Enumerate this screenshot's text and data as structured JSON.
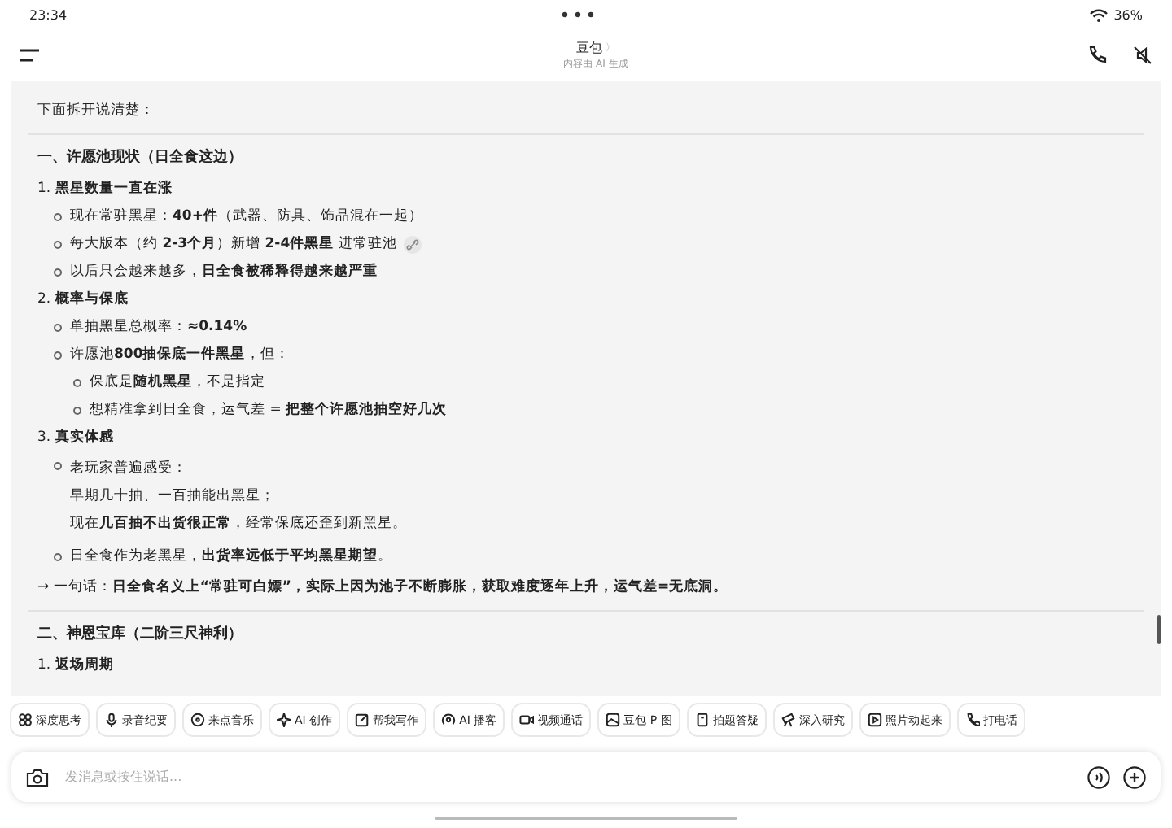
{
  "status_bar": {
    "time": "23:34",
    "battery": "36%"
  },
  "header": {
    "title": "豆包",
    "chevron": "〉",
    "subtitle": "内容由 AI 生成"
  },
  "content": [
    {
      "kind": "paragraph",
      "text": "下面拆开说清楚："
    },
    {
      "kind": "divider"
    },
    {
      "kind": "heading",
      "text": "一、许愿池现状（日全食这边）"
    },
    {
      "kind": "numbered",
      "number": "1.",
      "text": "黑星数量一直在涨",
      "children": [
        {
          "text": "现在常驻黑星：**40+件**（武器、防具、饰品混在一起）",
          "link": false
        },
        {
          "text": "每大版本（约 **2-3个月**）新增 **2-4件黑星** 进常驻池",
          "link": true
        },
        {
          "text": "以后只会越来越多，**日全食被稀释得越来越严重**",
          "link": false
        }
      ]
    },
    {
      "kind": "numbered",
      "number": "2.",
      "text": "概率与保底",
      "children": [
        {
          "text": "单抽黑星总概率：**≈0.14%**",
          "link": false
        },
        {
          "text": "许愿池**800抽保底一件黑星**，但：",
          "link": false,
          "children": [
            {
              "text": "保底是**随机黑星**，不是指定"
            },
            {
              "text": "想精准拿到日全食，运气差 = **把整个许愿池抽空好几次**"
            }
          ]
        }
      ]
    },
    {
      "kind": "numbered",
      "number": "3.",
      "text": "真实体感",
      "children": [
        {
          "lines": [
            "老玩家普遍感受：",
            "早期几十抽、一百抽能出黑星；",
            "现在**几百抽不出货很正常**，经常保底还歪到新黑星。"
          ],
          "link": false
        },
        {
          "text": "日全食作为老黑星，**出货率远低于平均黑星期望**。",
          "link": false
        }
      ]
    },
    {
      "kind": "paragraph",
      "text": "→ 一句话：**日全食名义上“常驻可白嫖”，实际上因为池子不断膨胀，获取难度逐年上升，运气差=无底洞。**"
    },
    {
      "kind": "divider"
    },
    {
      "kind": "heading",
      "text": "二、神恩宝库（二阶三尺神利）"
    },
    {
      "kind": "numbered",
      "number": "1.",
      "text": "返场周期"
    }
  ],
  "chips": [
    {
      "kind": "grid",
      "label": "深度思考"
    },
    {
      "kind": "mic",
      "label": "录音纪要"
    },
    {
      "kind": "music",
      "label": "来点音乐"
    },
    {
      "kind": "sparkle",
      "label": "AI 创作"
    },
    {
      "kind": "edit",
      "label": "帮我写作"
    },
    {
      "kind": "podcast",
      "label": "AI 播客"
    },
    {
      "kind": "video",
      "label": "视频通话"
    },
    {
      "kind": "image",
      "label": "豆包 P 图"
    },
    {
      "kind": "book",
      "label": "拍题答疑"
    },
    {
      "kind": "telescope",
      "label": "深入研究"
    },
    {
      "kind": "play",
      "label": "照片动起来"
    },
    {
      "kind": "phone",
      "label": "打电话"
    }
  ],
  "input": {
    "placeholder": "发消息或按住说话..."
  }
}
